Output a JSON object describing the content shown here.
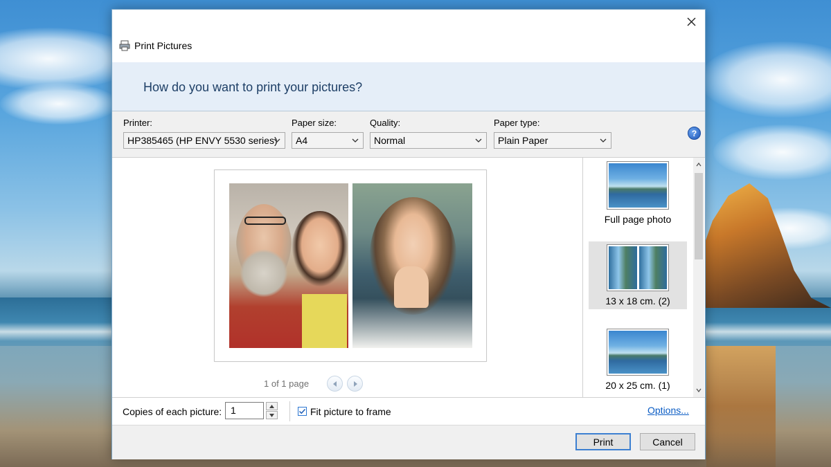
{
  "dialog": {
    "title": "Print Pictures",
    "question": "How do you want to print your pictures?"
  },
  "toolbar": {
    "printer_label": "Printer:",
    "printer_value": "HP385465 (HP ENVY 5530 series)",
    "paper_size_label": "Paper size:",
    "paper_size_value": "A4",
    "quality_label": "Quality:",
    "quality_value": "Normal",
    "paper_type_label": "Paper type:",
    "paper_type_value": "Plain Paper",
    "help_icon_text": "?"
  },
  "preview": {
    "page_indicator": "1 of 1 page"
  },
  "layouts": [
    {
      "label": "Full page photo",
      "selected": false
    },
    {
      "label": "13 x 18 cm. (2)",
      "selected": true
    },
    {
      "label": "20 x 25 cm. (1)",
      "selected": false
    }
  ],
  "footer": {
    "copies_label": "Copies of each picture:",
    "copies_value": "1",
    "fit_label": "Fit picture to frame",
    "fit_checked": true,
    "options_link": "Options...",
    "print_button": "Print",
    "cancel_button": "Cancel"
  },
  "icons": {
    "close": "close-icon",
    "printer": "printer-icon",
    "help": "help-icon",
    "dropdown": "chevron-down-icon",
    "prev": "arrow-left-icon",
    "next": "arrow-right-icon"
  },
  "colors": {
    "header_band": "#e5eef8",
    "question_text": "#1e3f66",
    "link": "#0a5cc4",
    "default_button_border": "#3c7fd1"
  }
}
